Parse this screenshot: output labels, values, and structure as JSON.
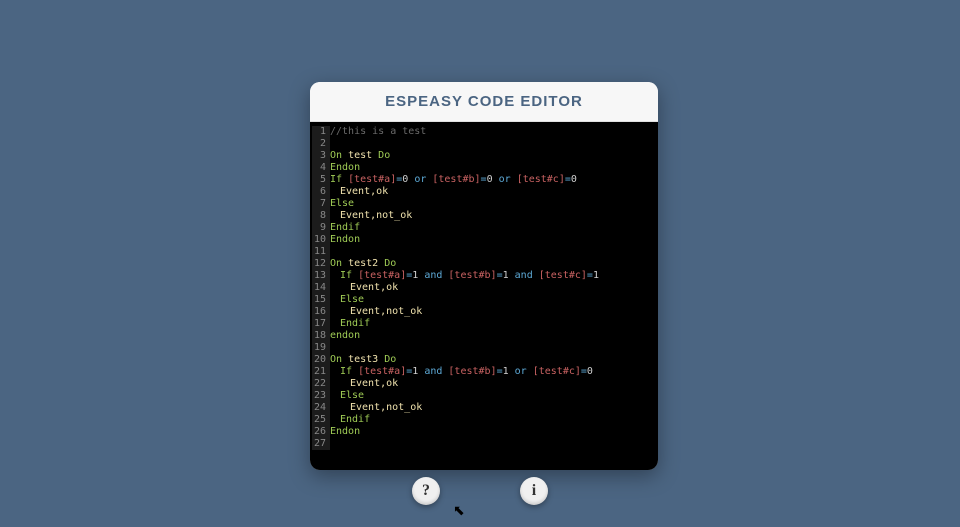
{
  "header": {
    "title": "ESPEASY CODE EDITOR"
  },
  "code": {
    "lineCount": 27,
    "lines": [
      {
        "indent": 0,
        "tokens": [
          {
            "t": "comment",
            "v": "//this is a test"
          }
        ]
      },
      {
        "indent": 0,
        "tokens": []
      },
      {
        "indent": 0,
        "tokens": [
          {
            "t": "kw",
            "v": "On "
          },
          {
            "t": "eventkw",
            "v": "test "
          },
          {
            "t": "kw",
            "v": "Do"
          }
        ]
      },
      {
        "indent": 0,
        "tokens": [
          {
            "t": "kw",
            "v": "Endon"
          }
        ]
      },
      {
        "indent": 0,
        "tokens": [
          {
            "t": "kw",
            "v": "If "
          },
          {
            "t": "ref",
            "v": "[test#a]"
          },
          {
            "t": "op",
            "v": "="
          },
          {
            "t": "num",
            "v": "0 "
          },
          {
            "t": "op",
            "v": "or "
          },
          {
            "t": "ref",
            "v": "[test#b]"
          },
          {
            "t": "op",
            "v": "="
          },
          {
            "t": "num",
            "v": "0 "
          },
          {
            "t": "op",
            "v": "or "
          },
          {
            "t": "ref",
            "v": "[test#c]"
          },
          {
            "t": "op",
            "v": "="
          },
          {
            "t": "num",
            "v": "0"
          }
        ]
      },
      {
        "indent": 1,
        "tokens": [
          {
            "t": "eventkw",
            "v": "Event,ok"
          }
        ]
      },
      {
        "indent": 0,
        "tokens": [
          {
            "t": "kw",
            "v": "Else"
          }
        ]
      },
      {
        "indent": 1,
        "tokens": [
          {
            "t": "eventkw",
            "v": "Event,not_ok"
          }
        ]
      },
      {
        "indent": 0,
        "tokens": [
          {
            "t": "kw",
            "v": "Endif"
          }
        ]
      },
      {
        "indent": 0,
        "tokens": [
          {
            "t": "kw",
            "v": "Endon"
          }
        ]
      },
      {
        "indent": 0,
        "tokens": []
      },
      {
        "indent": 0,
        "tokens": [
          {
            "t": "kw",
            "v": "On "
          },
          {
            "t": "eventkw",
            "v": "test2 "
          },
          {
            "t": "kw",
            "v": "Do"
          }
        ]
      },
      {
        "indent": 1,
        "tokens": [
          {
            "t": "kw",
            "v": "If "
          },
          {
            "t": "ref",
            "v": "[test#a]"
          },
          {
            "t": "op",
            "v": "="
          },
          {
            "t": "num",
            "v": "1 "
          },
          {
            "t": "op",
            "v": "and "
          },
          {
            "t": "ref",
            "v": "[test#b]"
          },
          {
            "t": "op",
            "v": "="
          },
          {
            "t": "num",
            "v": "1 "
          },
          {
            "t": "op",
            "v": "and "
          },
          {
            "t": "ref",
            "v": "[test#c]"
          },
          {
            "t": "op",
            "v": "="
          },
          {
            "t": "num",
            "v": "1"
          }
        ]
      },
      {
        "indent": 2,
        "tokens": [
          {
            "t": "eventkw",
            "v": "Event,ok"
          }
        ]
      },
      {
        "indent": 1,
        "tokens": [
          {
            "t": "kw",
            "v": "Else"
          }
        ]
      },
      {
        "indent": 2,
        "tokens": [
          {
            "t": "eventkw",
            "v": "Event,not_ok"
          }
        ]
      },
      {
        "indent": 1,
        "tokens": [
          {
            "t": "kw",
            "v": "Endif"
          }
        ]
      },
      {
        "indent": 0,
        "tokens": [
          {
            "t": "kw",
            "v": "endon"
          }
        ]
      },
      {
        "indent": 0,
        "tokens": []
      },
      {
        "indent": 0,
        "tokens": [
          {
            "t": "kw",
            "v": "On "
          },
          {
            "t": "eventkw",
            "v": "test3 "
          },
          {
            "t": "kw",
            "v": "Do"
          }
        ]
      },
      {
        "indent": 1,
        "tokens": [
          {
            "t": "kw",
            "v": "If "
          },
          {
            "t": "ref",
            "v": "[test#a]"
          },
          {
            "t": "op",
            "v": "="
          },
          {
            "t": "num",
            "v": "1 "
          },
          {
            "t": "op",
            "v": "and "
          },
          {
            "t": "ref",
            "v": "[test#b]"
          },
          {
            "t": "op",
            "v": "="
          },
          {
            "t": "num",
            "v": "1 "
          },
          {
            "t": "op",
            "v": "or "
          },
          {
            "t": "ref",
            "v": "[test#c]"
          },
          {
            "t": "op",
            "v": "="
          },
          {
            "t": "num",
            "v": "0"
          }
        ]
      },
      {
        "indent": 2,
        "tokens": [
          {
            "t": "eventkw",
            "v": "Event,ok"
          }
        ]
      },
      {
        "indent": 1,
        "tokens": [
          {
            "t": "kw",
            "v": "Else"
          }
        ]
      },
      {
        "indent": 2,
        "tokens": [
          {
            "t": "eventkw",
            "v": "Event,not_ok"
          }
        ]
      },
      {
        "indent": 1,
        "tokens": [
          {
            "t": "kw",
            "v": "Endif"
          }
        ]
      },
      {
        "indent": 0,
        "tokens": [
          {
            "t": "kw",
            "v": "Endon"
          }
        ]
      },
      {
        "indent": 0,
        "tokens": []
      }
    ]
  },
  "buttons": {
    "help_glyph": "?",
    "info_glyph": "i"
  }
}
